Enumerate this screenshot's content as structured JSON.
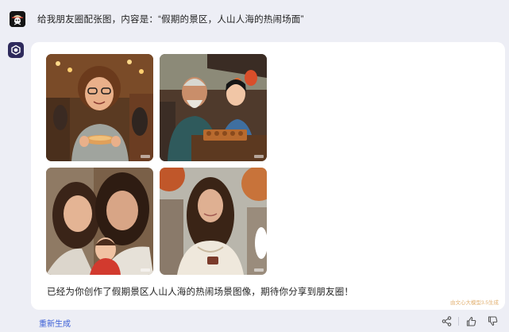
{
  "user_message": {
    "text": "给我朋友圈配张图，内容是：“假期的景区，人山人海的热闹场面”"
  },
  "bot_response": {
    "images": [
      {
        "name": "crowded-street-market-girl"
      },
      {
        "name": "market-vendors-food-stall"
      },
      {
        "name": "two-women-with-child"
      },
      {
        "name": "woman-autumn-street"
      }
    ],
    "text": "已经为你创作了假期景区人山人海的热闹场景图像，期待你分享到朋友圈！",
    "watermark": "由文心大模型3.5生成"
  },
  "footer": {
    "regenerate_label": "重新生成",
    "icons": [
      "share-icon",
      "thumbs-up-icon",
      "thumbs-down-icon"
    ]
  },
  "colors": {
    "page_bg": "#edeef5",
    "card_bg": "#ffffff",
    "link_blue": "#3c5fd6",
    "watermark": "#e2b070",
    "bot_avatar": "#2e2a5c"
  }
}
